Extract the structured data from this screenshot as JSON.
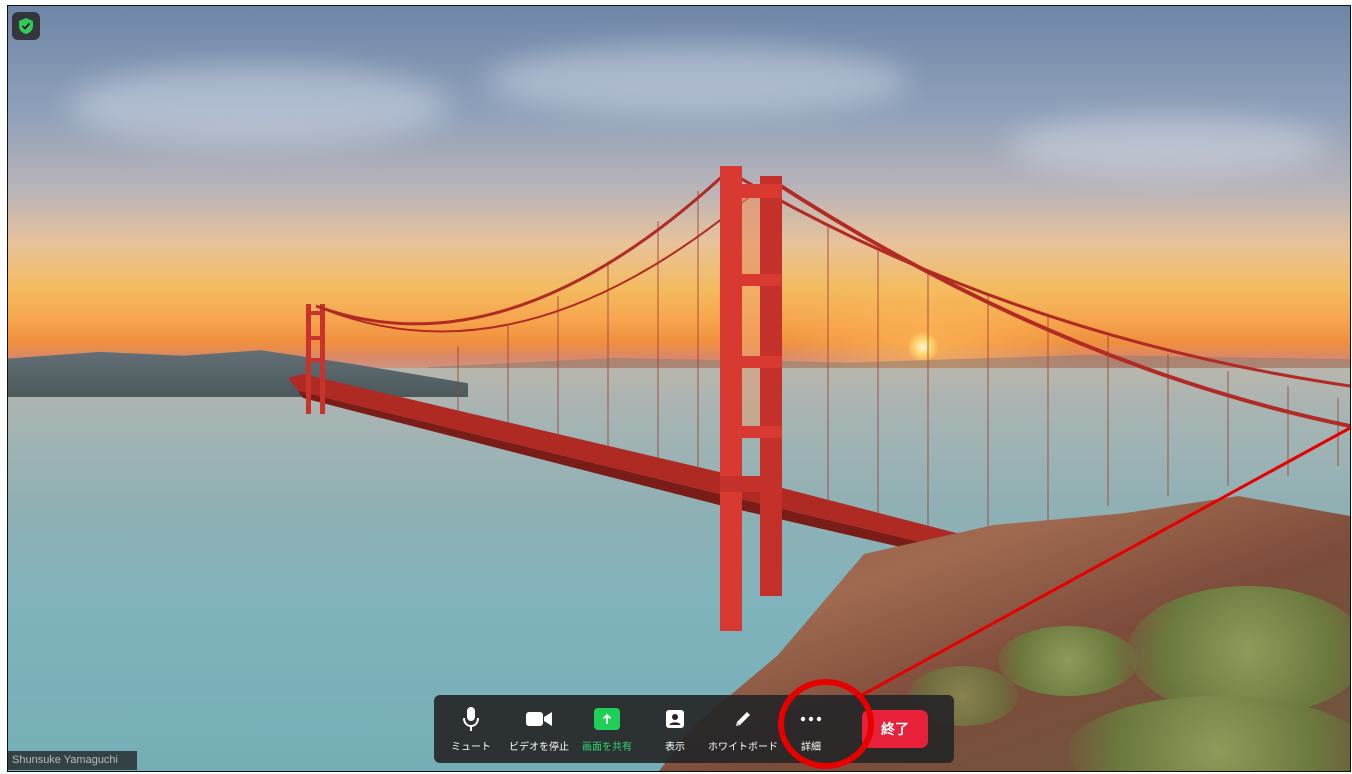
{
  "meeting": {
    "participant_name": "Shunsuke Yamaguchi",
    "security_icon": "shield-check-icon"
  },
  "toolbar": {
    "buttons": [
      {
        "id": "mute",
        "label": "ミュート",
        "icon": "microphone-icon"
      },
      {
        "id": "video",
        "label": "ビデオを停止",
        "icon": "video-camera-icon"
      },
      {
        "id": "share",
        "label": "画面を共有",
        "icon": "share-screen-icon",
        "color": "#1fcf57"
      },
      {
        "id": "view",
        "label": "表示",
        "icon": "person-view-icon"
      },
      {
        "id": "whiteboard",
        "label": "ホワイトボード",
        "icon": "pencil-icon"
      },
      {
        "id": "more",
        "label": "詳細",
        "icon": "more-dots-icon"
      }
    ],
    "end_label": "終了",
    "end_color": "#e8203a"
  },
  "annotation": {
    "highlight_color": "#e60000",
    "highlight_target": "more"
  }
}
